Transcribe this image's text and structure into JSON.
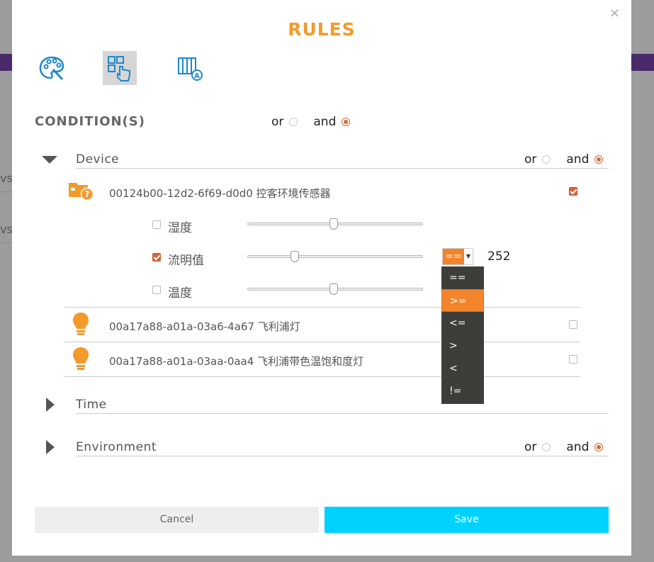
{
  "background": {
    "side_text_1": "vs",
    "side_text_2": "vs"
  },
  "modal": {
    "title": "RULES",
    "close_glyph": "×",
    "tabs": [
      {
        "icon": "palette-icon",
        "active": false
      },
      {
        "icon": "grid-touch-icon",
        "active": true
      },
      {
        "icon": "table-font-icon",
        "active": false
      }
    ]
  },
  "conditions": {
    "title": "CONDITION(S)",
    "or_label": "or",
    "and_label": "and",
    "selected": "and"
  },
  "device_section": {
    "label": "Device",
    "expanded": true,
    "or_label": "or",
    "and_label": "and",
    "selected": "and",
    "devices": [
      {
        "icon": "unknown-sensor-icon",
        "name": "00124b00-12d2-6f69-d0d0 控客环境传感器",
        "checked": true
      },
      {
        "icon": "light-bulb-icon",
        "name": "00a17a88-a01a-03a6-4a67 飞利浦灯",
        "checked": false
      },
      {
        "icon": "light-bulb-icon",
        "name": "00a17a88-a01a-03aa-0aa4 飞利浦带色温饱和度灯",
        "checked": false
      }
    ],
    "attributes": [
      {
        "label": "湿度",
        "checked": false,
        "slider_level": 0.5
      },
      {
        "label": "流明值",
        "checked": true,
        "slider_level": 0.27,
        "operator": "==",
        "value": "252"
      },
      {
        "label": "温度",
        "checked": false,
        "slider_level": 0.5
      }
    ]
  },
  "operator_dropdown": {
    "options": [
      "==",
      ">=",
      "<=",
      ">",
      "<",
      "!="
    ],
    "highlighted": ">="
  },
  "time_section": {
    "label": "Time",
    "expanded": false
  },
  "environment_section": {
    "label": "Environment",
    "expanded": false,
    "or_label": "or",
    "and_label": "and",
    "selected": "and"
  },
  "buttons": {
    "cancel": "Cancel",
    "save": "Save"
  },
  "colors": {
    "accent": "#f39a2b",
    "radio_on": "#d26a3c",
    "save_button": "#00d2ff",
    "dropdown_bg": "#3d3d3a"
  }
}
